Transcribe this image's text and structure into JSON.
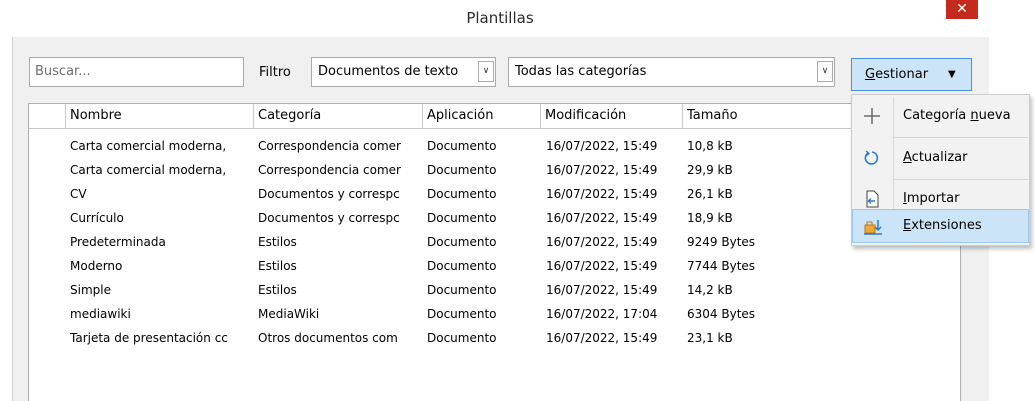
{
  "window": {
    "title": "Plantillas",
    "close_glyph": "✕"
  },
  "toolbar": {
    "search_placeholder": "Buscar...",
    "filter_label": "Filtro",
    "filter_value": "Documentos de texto",
    "category_value": "Todas las categorías",
    "manage_label": "Gestionar",
    "manage_mnemonic": "G",
    "manage_rest": "estionar"
  },
  "table": {
    "columns": [
      "Nombre",
      "Categoría",
      "Aplicación",
      "Modificación",
      "Tamaño"
    ],
    "rows": [
      [
        "Carta comercial moderna,",
        "Correspondencia comer",
        "Documento",
        "16/07/2022, 15:49",
        "10,8 kB"
      ],
      [
        "Carta comercial moderna,",
        "Correspondencia comer",
        "Documento",
        "16/07/2022, 15:49",
        "29,9 kB"
      ],
      [
        "CV",
        "Documentos y correspc",
        "Documento",
        "16/07/2022, 15:49",
        "26,1 kB"
      ],
      [
        "Currículo",
        "Documentos y correspc",
        "Documento",
        "16/07/2022, 15:49",
        "18,9 kB"
      ],
      [
        "Predeterminada",
        "Estilos",
        "Documento",
        "16/07/2022, 15:49",
        "9249 Bytes"
      ],
      [
        "Moderno",
        "Estilos",
        "Documento",
        "16/07/2022, 15:49",
        "7744 Bytes"
      ],
      [
        "Simple",
        "Estilos",
        "Documento",
        "16/07/2022, 15:49",
        "14,2 kB"
      ],
      [
        "mediawiki",
        "MediaWiki",
        "Documento",
        "16/07/2022, 17:04",
        "6304 Bytes"
      ],
      [
        "Tarjeta de presentación cc",
        "Otros documentos com",
        "Documento",
        "16/07/2022, 15:49",
        "23,1 kB"
      ]
    ]
  },
  "menu": {
    "items": [
      {
        "label_before": "Categoría ",
        "mnemonic": "n",
        "label_after": "ueva",
        "icon": "plus-icon"
      },
      {
        "label_before": "",
        "mnemonic": "A",
        "label_after": "ctualizar",
        "icon": "refresh-icon"
      },
      {
        "label_before": "",
        "mnemonic": "I",
        "label_after": "mportar",
        "icon": "import-icon"
      },
      {
        "label_before": "",
        "mnemonic": "E",
        "label_after": "xtensiones",
        "icon": "extensions-icon"
      }
    ]
  },
  "colors": {
    "accent": "#cce4f7",
    "close": "#c42b1c",
    "dialog_bg": "#f0f0f0"
  }
}
